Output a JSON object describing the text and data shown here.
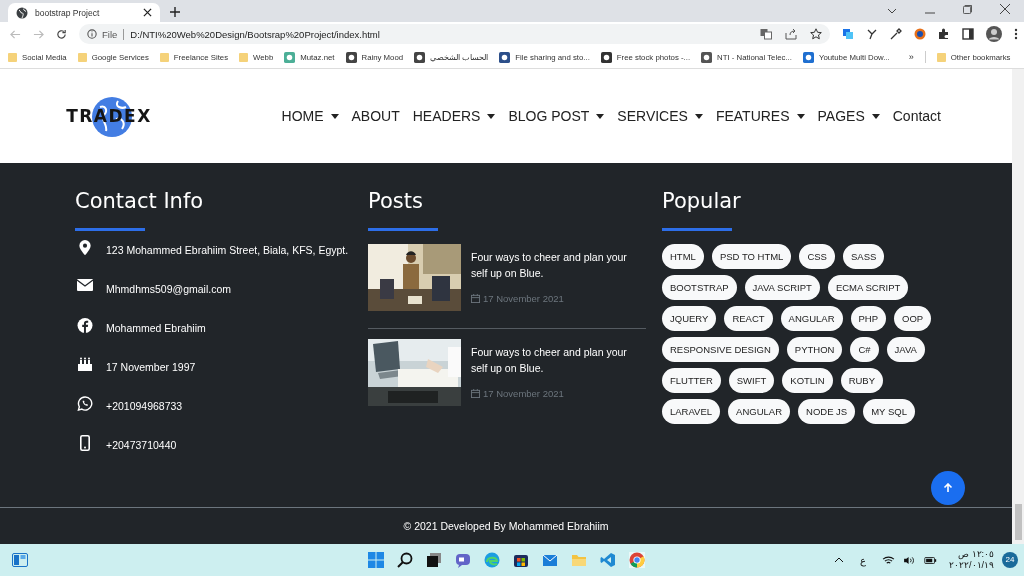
{
  "browser": {
    "tabs": [
      {
        "title": "bootstrap Project",
        "selected": true
      }
    ],
    "address": {
      "scheme": "File",
      "url": "D:/NTI%20Web%20Design/Bootsrap%20Project/index.html"
    },
    "bookmarks": [
      {
        "label": "Social Media",
        "kind": "folder"
      },
      {
        "label": "Google Services",
        "kind": "folder"
      },
      {
        "label": "Freelance Sites",
        "kind": "folder"
      },
      {
        "label": "Webb",
        "kind": "folder"
      },
      {
        "label": "Mutaz.net",
        "kind": "site"
      },
      {
        "label": "Rainy Mood",
        "kind": "site"
      },
      {
        "label": "الحساب الشخصي",
        "kind": "site"
      },
      {
        "label": "File sharing and sto...",
        "kind": "site"
      },
      {
        "label": "Free stock photos -...",
        "kind": "site"
      },
      {
        "label": "NTI - National Telec...",
        "kind": "site"
      },
      {
        "label": "Youtube Multi Dow...",
        "kind": "site"
      }
    ],
    "overflow": "»",
    "other_bookmarks": "Other bookmarks"
  },
  "site": {
    "logo": "TRADEX",
    "nav": [
      {
        "label": "HOME",
        "dropdown": true
      },
      {
        "label": "ABOUT",
        "dropdown": false
      },
      {
        "label": "HEADERS",
        "dropdown": true
      },
      {
        "label": "BLOG POST",
        "dropdown": true
      },
      {
        "label": "SERVICES",
        "dropdown": true
      },
      {
        "label": "FEATURES",
        "dropdown": true
      },
      {
        "label": "PAGES",
        "dropdown": true
      },
      {
        "label": "Contact",
        "dropdown": false
      }
    ],
    "contact": {
      "title": "Contact Info",
      "items": [
        {
          "kind": "location",
          "text": "123 Mohammed Ebrahiim Street, Biala, KFS, Egypt."
        },
        {
          "kind": "email",
          "text": "Mhmdhms509@gmail.com"
        },
        {
          "kind": "facebook",
          "text": "Mohammed Ebrahiim"
        },
        {
          "kind": "birthday",
          "text": "17 November 1997"
        },
        {
          "kind": "whatsapp",
          "text": "+201094968733"
        },
        {
          "kind": "phone",
          "text": "+20473710440"
        }
      ]
    },
    "posts": {
      "title": "Posts",
      "items": [
        {
          "title": "Four ways to cheer and plan your self up on Blue.",
          "date": "17 November 2021"
        },
        {
          "title": "Four ways to cheer and plan your self up on Blue.",
          "date": "17 November 2021"
        }
      ]
    },
    "popular": {
      "title": "Popular",
      "tags": [
        "HTML",
        "PSD TO HTML",
        "CSS",
        "SASS",
        "BOOTSTRAP",
        "JAVA SCRIPT",
        "ECMA SCRIPT",
        "JQUERY",
        "REACT",
        "ANGULAR",
        "PHP",
        "OOP",
        "RESPONSIVE DESIGN",
        "PYTHON",
        "C#",
        "JAVA",
        "FLUTTER",
        "SWIFT",
        "KOTLIN",
        "RUBY",
        "LARAVEL",
        "ANGULAR",
        "NODE JS",
        "MY SQL"
      ]
    },
    "copyright": "© 2021 Developed By Mohammed Ebrahiim"
  },
  "taskbar": {
    "language": "ع",
    "time": "١٢:٠٥ ص",
    "date": "٢٠٢٢/٠١/١٩",
    "notifications": "24"
  }
}
